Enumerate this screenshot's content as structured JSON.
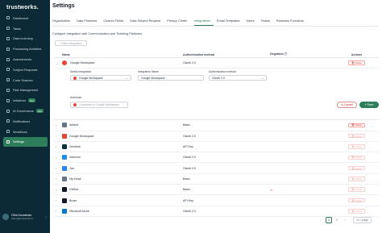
{
  "sidebar": {
    "logo": "trustworks.",
    "items": [
      {
        "label": "Dashboard",
        "icon": "dashboard-icon"
      },
      {
        "label": "Tasks",
        "icon": "tasks-icon"
      },
      {
        "label": "Data inventory",
        "icon": "database-icon"
      },
      {
        "label": "Processing Activities",
        "icon": "activities-icon"
      },
      {
        "label": "Assessments",
        "icon": "assessment-icon"
      },
      {
        "label": "Subject Requests",
        "icon": "requests-icon"
      },
      {
        "label": "Code Scanner",
        "icon": "code-icon"
      },
      {
        "label": "Risk Management",
        "icon": "risk-icon"
      },
      {
        "label": "Initiatives",
        "icon": "initiatives-icon",
        "badge": "New"
      },
      {
        "label": "AI Governance",
        "icon": "ai-icon",
        "badge": "New"
      },
      {
        "label": "Notifications",
        "icon": "bell-icon"
      },
      {
        "label": "Workflows",
        "icon": "workflow-icon"
      },
      {
        "label": "Settings",
        "icon": "gear-icon",
        "active": true
      }
    ],
    "user": {
      "name": "Olha Kovalenko",
      "email": "olha.k@trustworks.io"
    }
  },
  "header": {
    "title": "Settings"
  },
  "tabs": [
    "Organisation",
    "Data Practices",
    "Custom Fields",
    "Data Subject Request",
    "Privacy Center",
    "Integrations",
    "Email Templates",
    "Users",
    "Teams",
    "Business Functions"
  ],
  "active_tab": "Integrations",
  "section_desc": "Configure Integration with Communication and Ticketing Platforms",
  "new_button": "New Integration",
  "table": {
    "headers": {
      "name": "Name",
      "auth": "Authentication method",
      "degraded": "Degraded",
      "actions": "Actions"
    },
    "expanded": {
      "name": "Google Workspace",
      "auth": "OAuth 2.0",
      "select_label": "Select Integration",
      "select_value": "Google Workspace",
      "name_label": "Integration Name",
      "name_value": "Google Workspace",
      "auth_label": "Authentication method",
      "auth_value": "OAuth 2.0",
      "authorize_label": "Authorize",
      "connect_label": "Connected to Google Workspace",
      "cancel_label": "Cancel",
      "save_label": "Save"
    },
    "rows": [
      {
        "name": "default",
        "auth": "Basic",
        "degraded": false,
        "color": "#64748b"
      },
      {
        "name": "Google Workspace",
        "auth": "OAuth 2.0",
        "degraded": false,
        "color": "#ea4335"
      },
      {
        "name": "Zendesk",
        "auth": "API Key",
        "degraded": false,
        "color": "#03363d"
      },
      {
        "name": "Intercom",
        "auth": "OAuth 2.0",
        "degraded": false,
        "color": "#1f8ded"
      },
      {
        "name": "Jira",
        "auth": "OAuth 2.0",
        "degraded": false,
        "color": "#2684ff"
      },
      {
        "name": "My email",
        "auth": "Basic",
        "degraded": false,
        "color": "#64748b"
      },
      {
        "name": "GitHub",
        "auth": "Basic",
        "degraded": true,
        "color": "#111827"
      },
      {
        "name": "Braze",
        "auth": "API Key",
        "degraded": false,
        "color": "#111827"
      },
      {
        "name": "Microsoft Azure",
        "auth": "OAuth 2.0",
        "degraded": false,
        "color": "#0078d4"
      }
    ],
    "delete_label": "Delete"
  },
  "pagination": {
    "pages": [
      "1",
      "2"
    ],
    "current": "1",
    "page_size": "10 / page"
  }
}
